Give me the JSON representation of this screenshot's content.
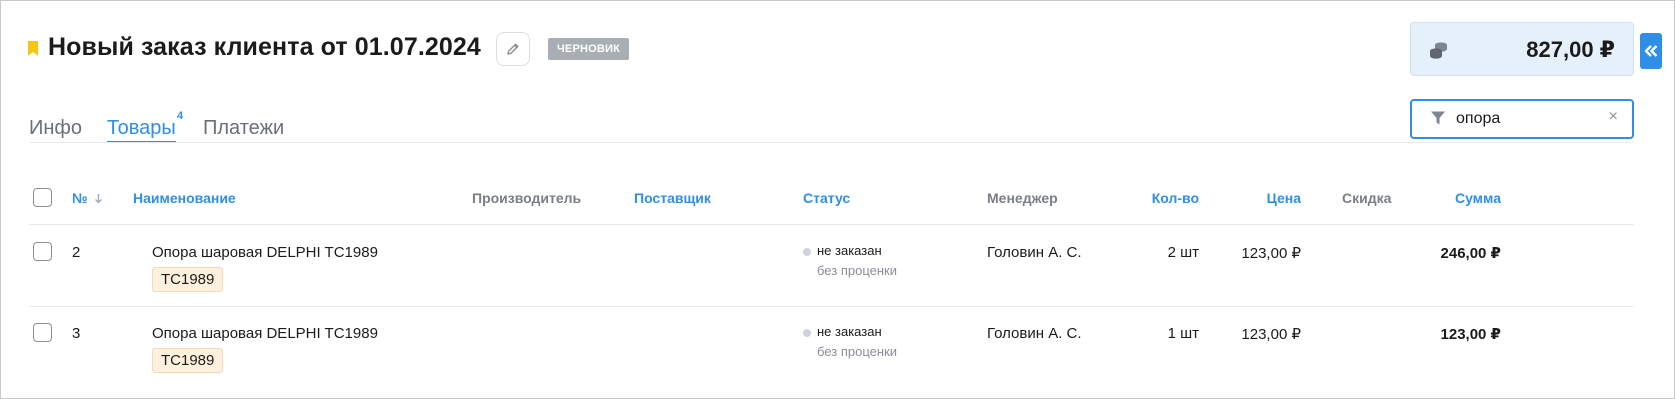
{
  "header": {
    "title": "Новый заказ клиента от 01.07.2024",
    "status_badge": "ЧЕРНОВИК",
    "total_amount": "827,00 ₽"
  },
  "tabs": [
    {
      "label": "Инфо",
      "active": false
    },
    {
      "label": "Товары",
      "active": true,
      "count": "4"
    },
    {
      "label": "Платежи",
      "active": false
    }
  ],
  "search": {
    "value": "опора",
    "clear_icon": "×"
  },
  "table": {
    "columns": {
      "number": "№",
      "name": "Наименование",
      "manufacturer": "Производитель",
      "supplier": "Поставщик",
      "status": "Статус",
      "manager": "Менеджер",
      "quantity": "Кол-во",
      "price": "Цена",
      "discount": "Скидка",
      "sum": "Сумма"
    },
    "rows": [
      {
        "number": "2",
        "name": "Опора шаровая DELPHI TC1989",
        "article": "TC1989",
        "status": "не заказан",
        "status_note": "без проценки",
        "manager": "Головин А. С.",
        "quantity": "2 шт",
        "price": "123,00 ₽",
        "sum": "246,00 ₽"
      },
      {
        "number": "3",
        "name": "Опора шаровая DELPHI TC1989",
        "article": "TC1989",
        "status": "не заказан",
        "status_note": "без проценки",
        "manager": "Головин А. С.",
        "quantity": "1 шт",
        "price": "123,00 ₽",
        "sum": "123,00 ₽"
      }
    ]
  },
  "colors": {
    "accent": "#2f8fe6",
    "bookmark": "#f5c518",
    "badge": "#a9aeb5",
    "total_bg": "#e6f0fb",
    "tag_bg": "#fdf0dc"
  },
  "icons": {
    "bookmark": "bookmark-icon",
    "edit": "pencil-icon",
    "coins": "coins-icon",
    "collapse": "double-chevron-left-icon",
    "filter": "filter-icon",
    "sort": "sort-down-icon"
  }
}
